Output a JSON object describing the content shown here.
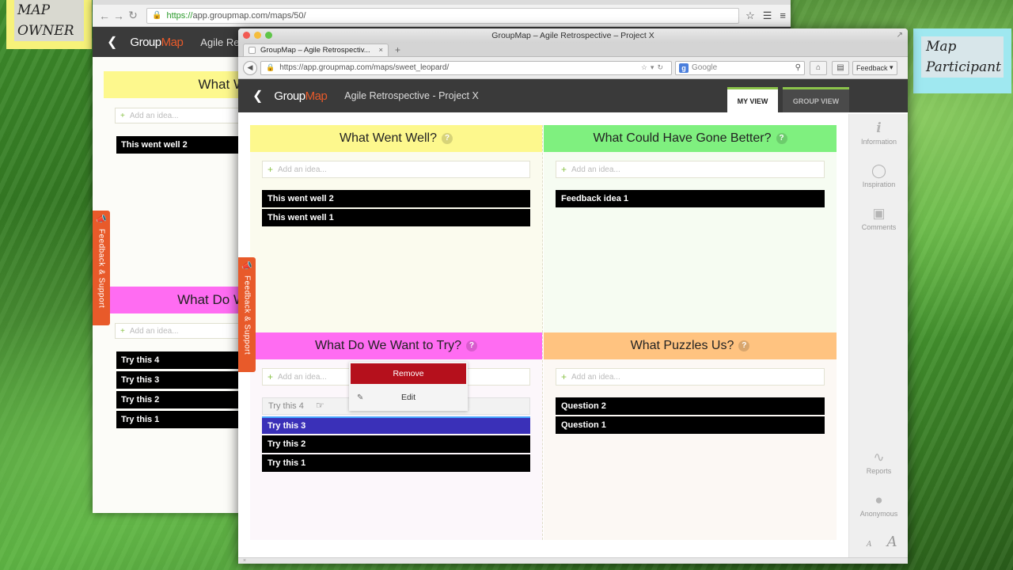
{
  "sticky_owner": {
    "line1": "MAP",
    "line2": "OWNER"
  },
  "sticky_participant": {
    "line1": "Map",
    "line2": "Participant"
  },
  "back_window": {
    "url_secure": "https://",
    "url_rest": "app.groupmap.com/maps/50/",
    "logo_group": "Group",
    "logo_map": "Map",
    "title": "Agile Retro",
    "q1_label": "What W",
    "q3_label": "What Do W",
    "add_idea": "Add an idea...",
    "q1_cards": [
      "This went well 2"
    ],
    "q3_cards": [
      "Try this 4",
      "Try this 3",
      "Try this 2",
      "Try this 1"
    ],
    "feedback_tab": "Feedback & Support"
  },
  "front_window": {
    "window_title": "GroupMap – Agile Retrospective – Project X",
    "tab_title": "GroupMap – Agile Retrospectiv...",
    "url": "https://app.groupmap.com/maps/sweet_leopard/",
    "search_placeholder": "Google",
    "feedback_button": "Feedback",
    "logo_group": "Group",
    "logo_map": "Map",
    "title": "Agile Retrospective - Project X",
    "view_tabs": {
      "my_view": "MY VIEW",
      "group_view": "GROUP VIEW"
    },
    "feedback_tab": "Feedback & Support",
    "add_idea": "Add an idea...",
    "quadrants": {
      "q1": {
        "title": "What Went Well?",
        "cards": [
          "This went well 2",
          "This went well 1"
        ]
      },
      "q2": {
        "title": "What Could Have Gone Better?",
        "cards": [
          "Feedback idea 1"
        ]
      },
      "q3": {
        "title": "What Do We Want to Try?",
        "cards": [
          "Try this 4",
          "Try this 3",
          "Try this 2",
          "Try this 1"
        ]
      },
      "q4": {
        "title": "What Puzzles Us?",
        "cards": [
          "Question 2",
          "Question 1"
        ]
      }
    },
    "context_menu": {
      "remove": "Remove",
      "edit": "Edit"
    },
    "right_sidebar": {
      "information": "Information",
      "inspiration": "Inspiration",
      "comments": "Comments",
      "reports": "Reports",
      "anonymous": "Anonymous",
      "font_small": "A",
      "font_large": "A"
    }
  },
  "colors": {
    "accent": "#e85a2a",
    "q1": "#fdf88d",
    "q2": "#7ff07f",
    "q3": "#ff6cf2",
    "q4": "#ffc380",
    "remove": "#b5101c",
    "selected_card": "#3a30b8"
  }
}
